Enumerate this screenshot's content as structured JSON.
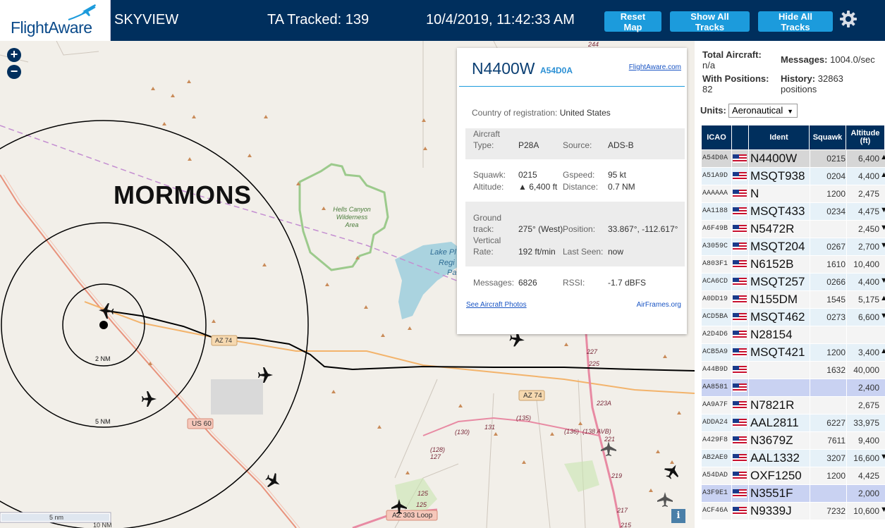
{
  "header": {
    "logo": "FlightAware",
    "app_name": "SKYVIEW",
    "ta_tracked": "TA Tracked: 139",
    "datetime": "10/4/2019, 11:42:33 AM",
    "btn_reset": "Reset Map",
    "btn_show": "Show All Tracks",
    "btn_hide": "Hide All Tracks"
  },
  "map": {
    "overlay_text": "MORMONS",
    "wilderness": "Hells Canyon Wilderness Area",
    "lake_partial": [
      "Lake Pl",
      "Regi",
      "Pa"
    ],
    "range_labels": [
      "2 NM",
      "5 NM"
    ],
    "road_labels": [
      "AZ 74",
      "AZ 74",
      "US 60",
      "AZ 303 Loop",
      "244",
      "227",
      "225",
      "223A",
      "221",
      "219",
      "217",
      "215",
      "(130)",
      "131",
      "(135)",
      "(136)",
      "(138 AVB)",
      "(128)",
      "127",
      "125",
      "125"
    ],
    "scale_5": "5 nm",
    "scale_10": "10 NM",
    "zoom_in": "+",
    "zoom_out": "−",
    "info": "i"
  },
  "popup": {
    "ident": "N4400W",
    "hex": "A54D0A",
    "fa_link": "FlightAware.com",
    "country_label": "Country of registration:",
    "country_value": "United States",
    "aircraft_type_label": "Aircraft Type:",
    "aircraft_type_label_1": "Aircraft",
    "aircraft_type_label_2": "Type:",
    "aircraft_type_value": "P28A",
    "source_label": "Source:",
    "source_value": "ADS-B",
    "squawk_label": "Squawk:",
    "squawk_value": "0215",
    "gspeed_label": "Gspeed:",
    "gspeed_value": "95 kt",
    "altitude_label": "Altitude:",
    "altitude_value": "▲ 6,400 ft",
    "distance_label": "Distance:",
    "distance_value": "0.7 NM",
    "ground_label_1": "Ground",
    "ground_label_2": "track:",
    "ground_value": "275° (West)",
    "position_label": "Position:",
    "position_value": "33.867°, -112.617°",
    "vrate_label_1": "Vertical",
    "vrate_label_2": "Rate:",
    "vrate_value": "192 ft/min",
    "lastseen_label": "Last Seen:",
    "lastseen_value": "now",
    "messages_label": "Messages:",
    "messages_value": "6826",
    "rssi_label": "RSSI:",
    "rssi_value": "-1.7 dBFS",
    "photos_link": "See Aircraft Photos",
    "airframes_link": "AirFrames.org"
  },
  "sidebar": {
    "total_label": "Total Aircraft:",
    "total_value": "n/a",
    "messages_label": "Messages:",
    "messages_value": "1004.0/sec",
    "withpos_label": "With Positions:",
    "withpos_value": "82",
    "history_label": "History:",
    "history_value": "32863",
    "history_unit": "positions",
    "units_label": "Units:",
    "units_value": "Aeronautical",
    "columns": [
      "ICAO",
      "Ident",
      "Squawk",
      "Altitude (ft)"
    ],
    "col_alt_1": "Altitude",
    "col_alt_2": "(ft)"
  },
  "rows": [
    {
      "icao": "A54D0A",
      "ident": "N4400W",
      "squawk": "0215",
      "alt": "6,400",
      "trend": "▲",
      "style": "sel"
    },
    {
      "icao": "A51A9D",
      "ident": "MSQT938",
      "squawk": "0204",
      "alt": "4,400",
      "trend": "▲",
      "style": ""
    },
    {
      "icao": "AAAAAA",
      "ident": "N",
      "squawk": "1200",
      "alt": "2,475",
      "trend": "",
      "style": "alt"
    },
    {
      "icao": "AA1188",
      "ident": "MSQT433",
      "squawk": "0234",
      "alt": "4,475",
      "trend": "▼",
      "style": ""
    },
    {
      "icao": "A6F49B",
      "ident": "N5472R",
      "squawk": "",
      "alt": "2,450",
      "trend": "▼",
      "style": "alt"
    },
    {
      "icao": "A3059C",
      "ident": "MSQT204",
      "squawk": "0267",
      "alt": "2,700",
      "trend": "▼",
      "style": ""
    },
    {
      "icao": "A803F1",
      "ident": "N6152B",
      "squawk": "1610",
      "alt": "10,400",
      "trend": "",
      "style": "alt"
    },
    {
      "icao": "ACA6CD",
      "ident": "MSQT257",
      "squawk": "0266",
      "alt": "4,400",
      "trend": "▼",
      "style": ""
    },
    {
      "icao": "A0DD19",
      "ident": "N155DM",
      "squawk": "1545",
      "alt": "5,175",
      "trend": "▲",
      "style": "alt"
    },
    {
      "icao": "ACD5BA",
      "ident": "MSQT462",
      "squawk": "0273",
      "alt": "6,600",
      "trend": "▼",
      "style": ""
    },
    {
      "icao": "A2D4D6",
      "ident": "N28154",
      "squawk": "",
      "alt": "",
      "trend": "",
      "style": "alt"
    },
    {
      "icao": "ACB5A9",
      "ident": "MSQT421",
      "squawk": "1200",
      "alt": "3,400",
      "trend": "▲",
      "style": ""
    },
    {
      "icao": "A44B9D",
      "ident": "",
      "squawk": "1632",
      "alt": "40,000",
      "trend": "",
      "style": "alt"
    },
    {
      "icao": "AA8581",
      "ident": "",
      "squawk": "",
      "alt": "2,400",
      "trend": "",
      "style": "hl"
    },
    {
      "icao": "AA9A7F",
      "ident": "N7821R",
      "squawk": "",
      "alt": "2,675",
      "trend": "",
      "style": "alt"
    },
    {
      "icao": "ADDA24",
      "ident": "AAL2811",
      "squawk": "6227",
      "alt": "33,975",
      "trend": "",
      "style": ""
    },
    {
      "icao": "A429F8",
      "ident": "N3679Z",
      "squawk": "7611",
      "alt": "9,400",
      "trend": "",
      "style": "alt"
    },
    {
      "icao": "AB2AE0",
      "ident": "AAL1332",
      "squawk": "3207",
      "alt": "16,600",
      "trend": "▼",
      "style": ""
    },
    {
      "icao": "A54DAD",
      "ident": "OXF1250",
      "squawk": "1200",
      "alt": "4,425",
      "trend": "",
      "style": "alt"
    },
    {
      "icao": "A3F9E1",
      "ident": "N3551F",
      "squawk": "",
      "alt": "2,000",
      "trend": "",
      "style": "hl"
    },
    {
      "icao": "ACF46A",
      "ident": "N9339J",
      "squawk": "7232",
      "alt": "10,600",
      "trend": "▼",
      "style": "alt"
    }
  ],
  "colors": {
    "header_bg": "#002f5d",
    "button": "#1c9bdc",
    "map_bg": "#f2efe9",
    "range_ring": "#000000",
    "track": "#000000"
  }
}
